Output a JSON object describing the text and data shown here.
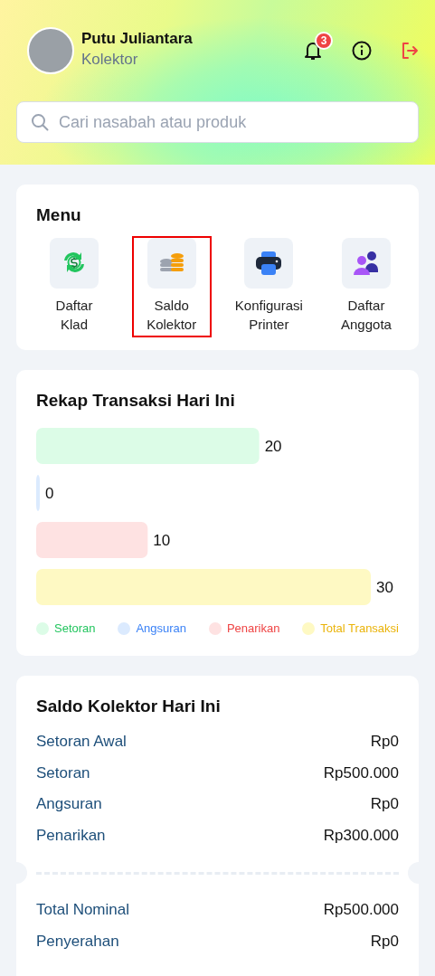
{
  "profile": {
    "name": "Putu Juliantara",
    "role": "Kolektor",
    "notification_count": "3"
  },
  "search": {
    "placeholder": "Cari nasabah atau produk"
  },
  "menu": {
    "title": "Menu",
    "items": [
      {
        "kind": "exchange",
        "line1": "Daftar",
        "line2": "Klad",
        "selected": false
      },
      {
        "kind": "coins",
        "line1": "Saldo",
        "line2": "Kolektor",
        "selected": true
      },
      {
        "kind": "printer",
        "line1": "Konfigurasi",
        "line2": "Printer",
        "selected": false
      },
      {
        "kind": "people",
        "line1": "Daftar",
        "line2": "Anggota",
        "selected": false
      }
    ]
  },
  "recap": {
    "title": "Rekap Transaksi Hari Ini",
    "chart_data": {
      "type": "bar",
      "orientation": "horizontal",
      "series": [
        {
          "name": "Setoran",
          "color": "#dcfce7",
          "values": [
            20
          ]
        },
        {
          "name": "Angsuran",
          "color": "#dbeafe",
          "values": [
            0
          ]
        },
        {
          "name": "Penarikan",
          "color": "#fee2e2",
          "values": [
            10
          ]
        },
        {
          "name": "Total Transaksi",
          "color": "#fef9c3",
          "values": [
            30
          ]
        }
      ],
      "data_labels": true
    },
    "legend_labels": [
      {
        "color": "#22c55e"
      },
      {
        "color": "#3b82f6"
      },
      {
        "color": "#ef4444"
      },
      {
        "color": "#eab308"
      }
    ]
  },
  "balance": {
    "title": "Saldo Kolektor Hari Ini",
    "rows": [
      {
        "label": "Setoran Awal",
        "value": "Rp0"
      },
      {
        "label": "Setoran",
        "value": "Rp500.000"
      },
      {
        "label": "Angsuran",
        "value": "Rp0"
      },
      {
        "label": "Penarikan",
        "value": "Rp300.000"
      }
    ],
    "totals": [
      {
        "label": "Total Nominal",
        "value": "Rp500.000"
      },
      {
        "label": "Penyerahan",
        "value": "Rp0"
      }
    ]
  }
}
